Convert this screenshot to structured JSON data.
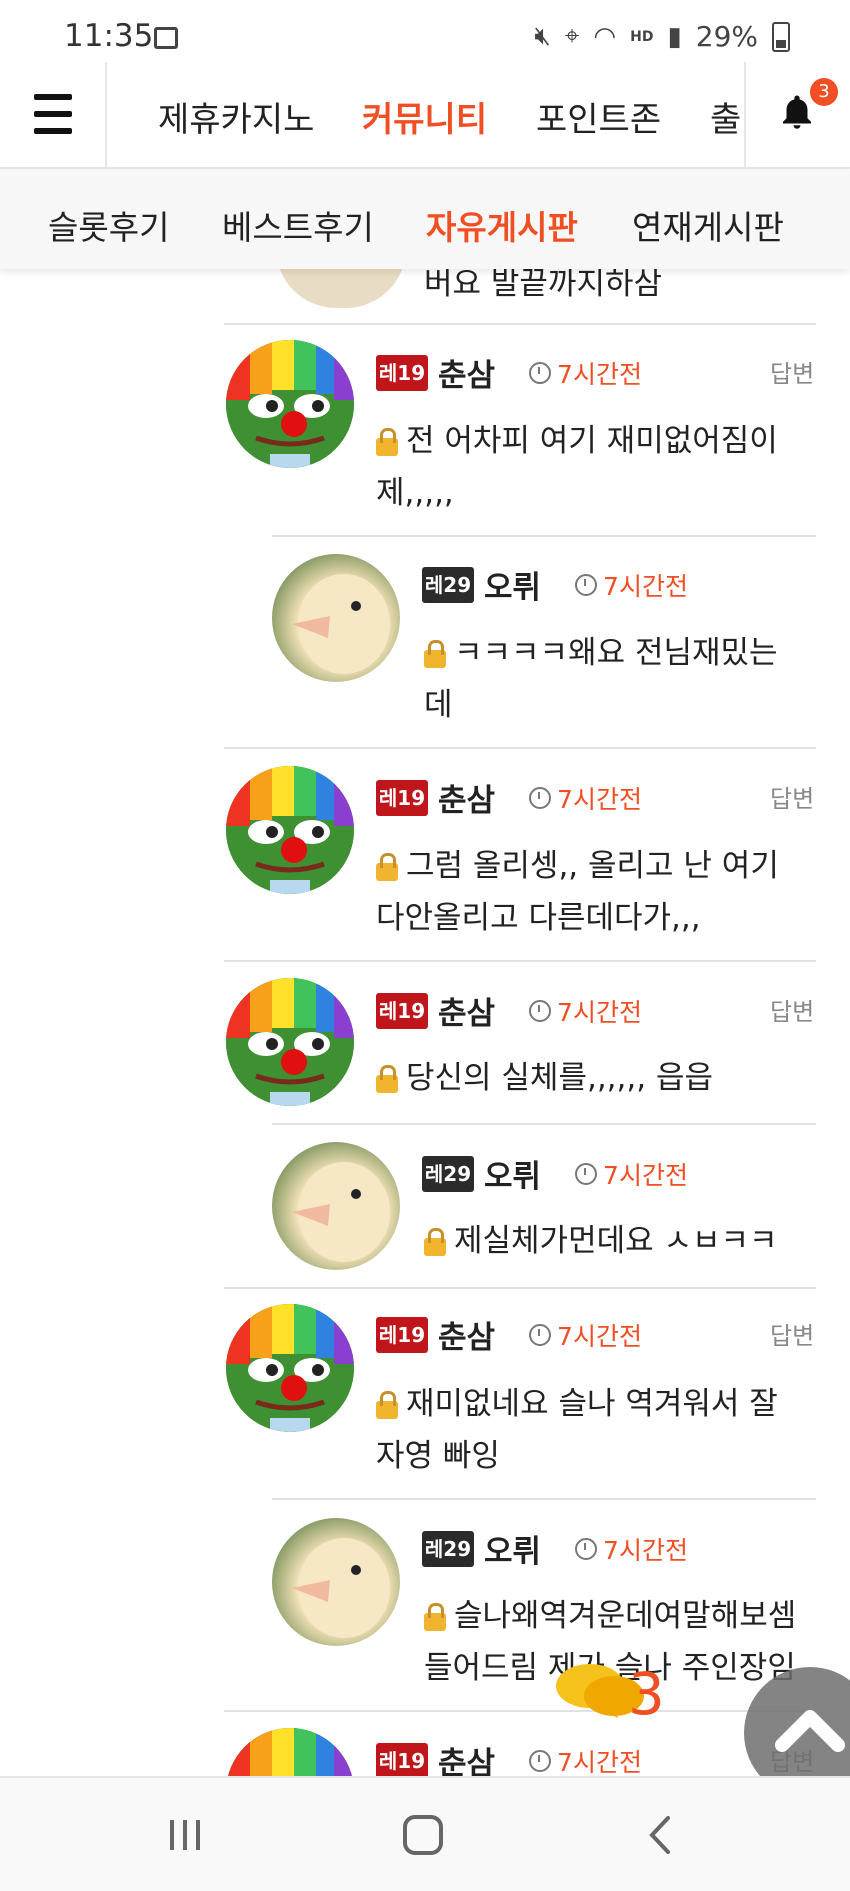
{
  "status_bar": {
    "time": "11:35",
    "battery": "29%",
    "icons": [
      "image-icon",
      "mute-icon",
      "location-icon",
      "wifi-icon",
      "hd-voice-icon",
      "signal-icon",
      "battery-icon"
    ]
  },
  "top_nav": {
    "items": [
      "제휴카지노",
      "커뮤니티",
      "포인트존",
      "출"
    ],
    "active": "커뮤니티",
    "notification_count": "3"
  },
  "sub_nav": {
    "items": [
      "슬롯후기",
      "베스트후기",
      "자유게시판",
      "연재게시판"
    ],
    "active": "자유게시판"
  },
  "previous_comment_tail": "버요 발끝까지하삼",
  "comments": [
    {
      "level": "레벨 19",
      "nick": "춘삼",
      "time": "7시간전",
      "reply": "답변",
      "text": "전 어차피 여기 재미없어짐이 제,,,,,",
      "avatar": "pepe-clown-avatar"
    },
    {
      "level": "레벨 29",
      "nick": "오뤼",
      "time": "7시간전",
      "text": "ㅋㅋㅋㅋ왜요 전님재밌는데",
      "avatar": "duckling-avatar"
    },
    {
      "level": "레벨 19",
      "nick": "춘삼",
      "time": "7시간전",
      "reply": "답변",
      "text": "그럼 올리셍,, 올리고 난 여기 다안올리고 다른데다가,,,",
      "avatar": "pepe-clown-avatar"
    },
    {
      "level": "레벨 19",
      "nick": "춘삼",
      "time": "7시간전",
      "reply": "답변",
      "text": "당신의 실체를,,,,,, 읍읍",
      "avatar": "pepe-clown-avatar"
    },
    {
      "level": "레벨 29",
      "nick": "오뤼",
      "time": "7시간전",
      "text": "제실체가먼데요 ㅅㅂㅋㅋ",
      "avatar": "duckling-avatar"
    },
    {
      "level": "레벨 19",
      "nick": "춘삼",
      "time": "7시간전",
      "reply": "답변",
      "text": "재미없네요 슬나 역겨워서 잘자영 빠잉",
      "avatar": "pepe-clown-avatar"
    },
    {
      "level": "레벨 29",
      "nick": "오뤼",
      "time": "7시간전",
      "text": "슬나왜역겨운데여말해보셈 들어드림 제가 슬나 주인장임",
      "avatar": "duckling-avatar"
    },
    {
      "level": "레벨 19",
      "nick": "춘삼",
      "time": "7시간전",
      "reply": "답변",
      "avatar": "pepe-clown-avatar"
    }
  ],
  "level_badge_text": {
    "red": "레19",
    "black": "레29"
  },
  "floating": {
    "comment_count": "3"
  },
  "colors": {
    "accent": "#f04e23",
    "level19": "#c0151b",
    "level29": "#2b2b2b"
  }
}
